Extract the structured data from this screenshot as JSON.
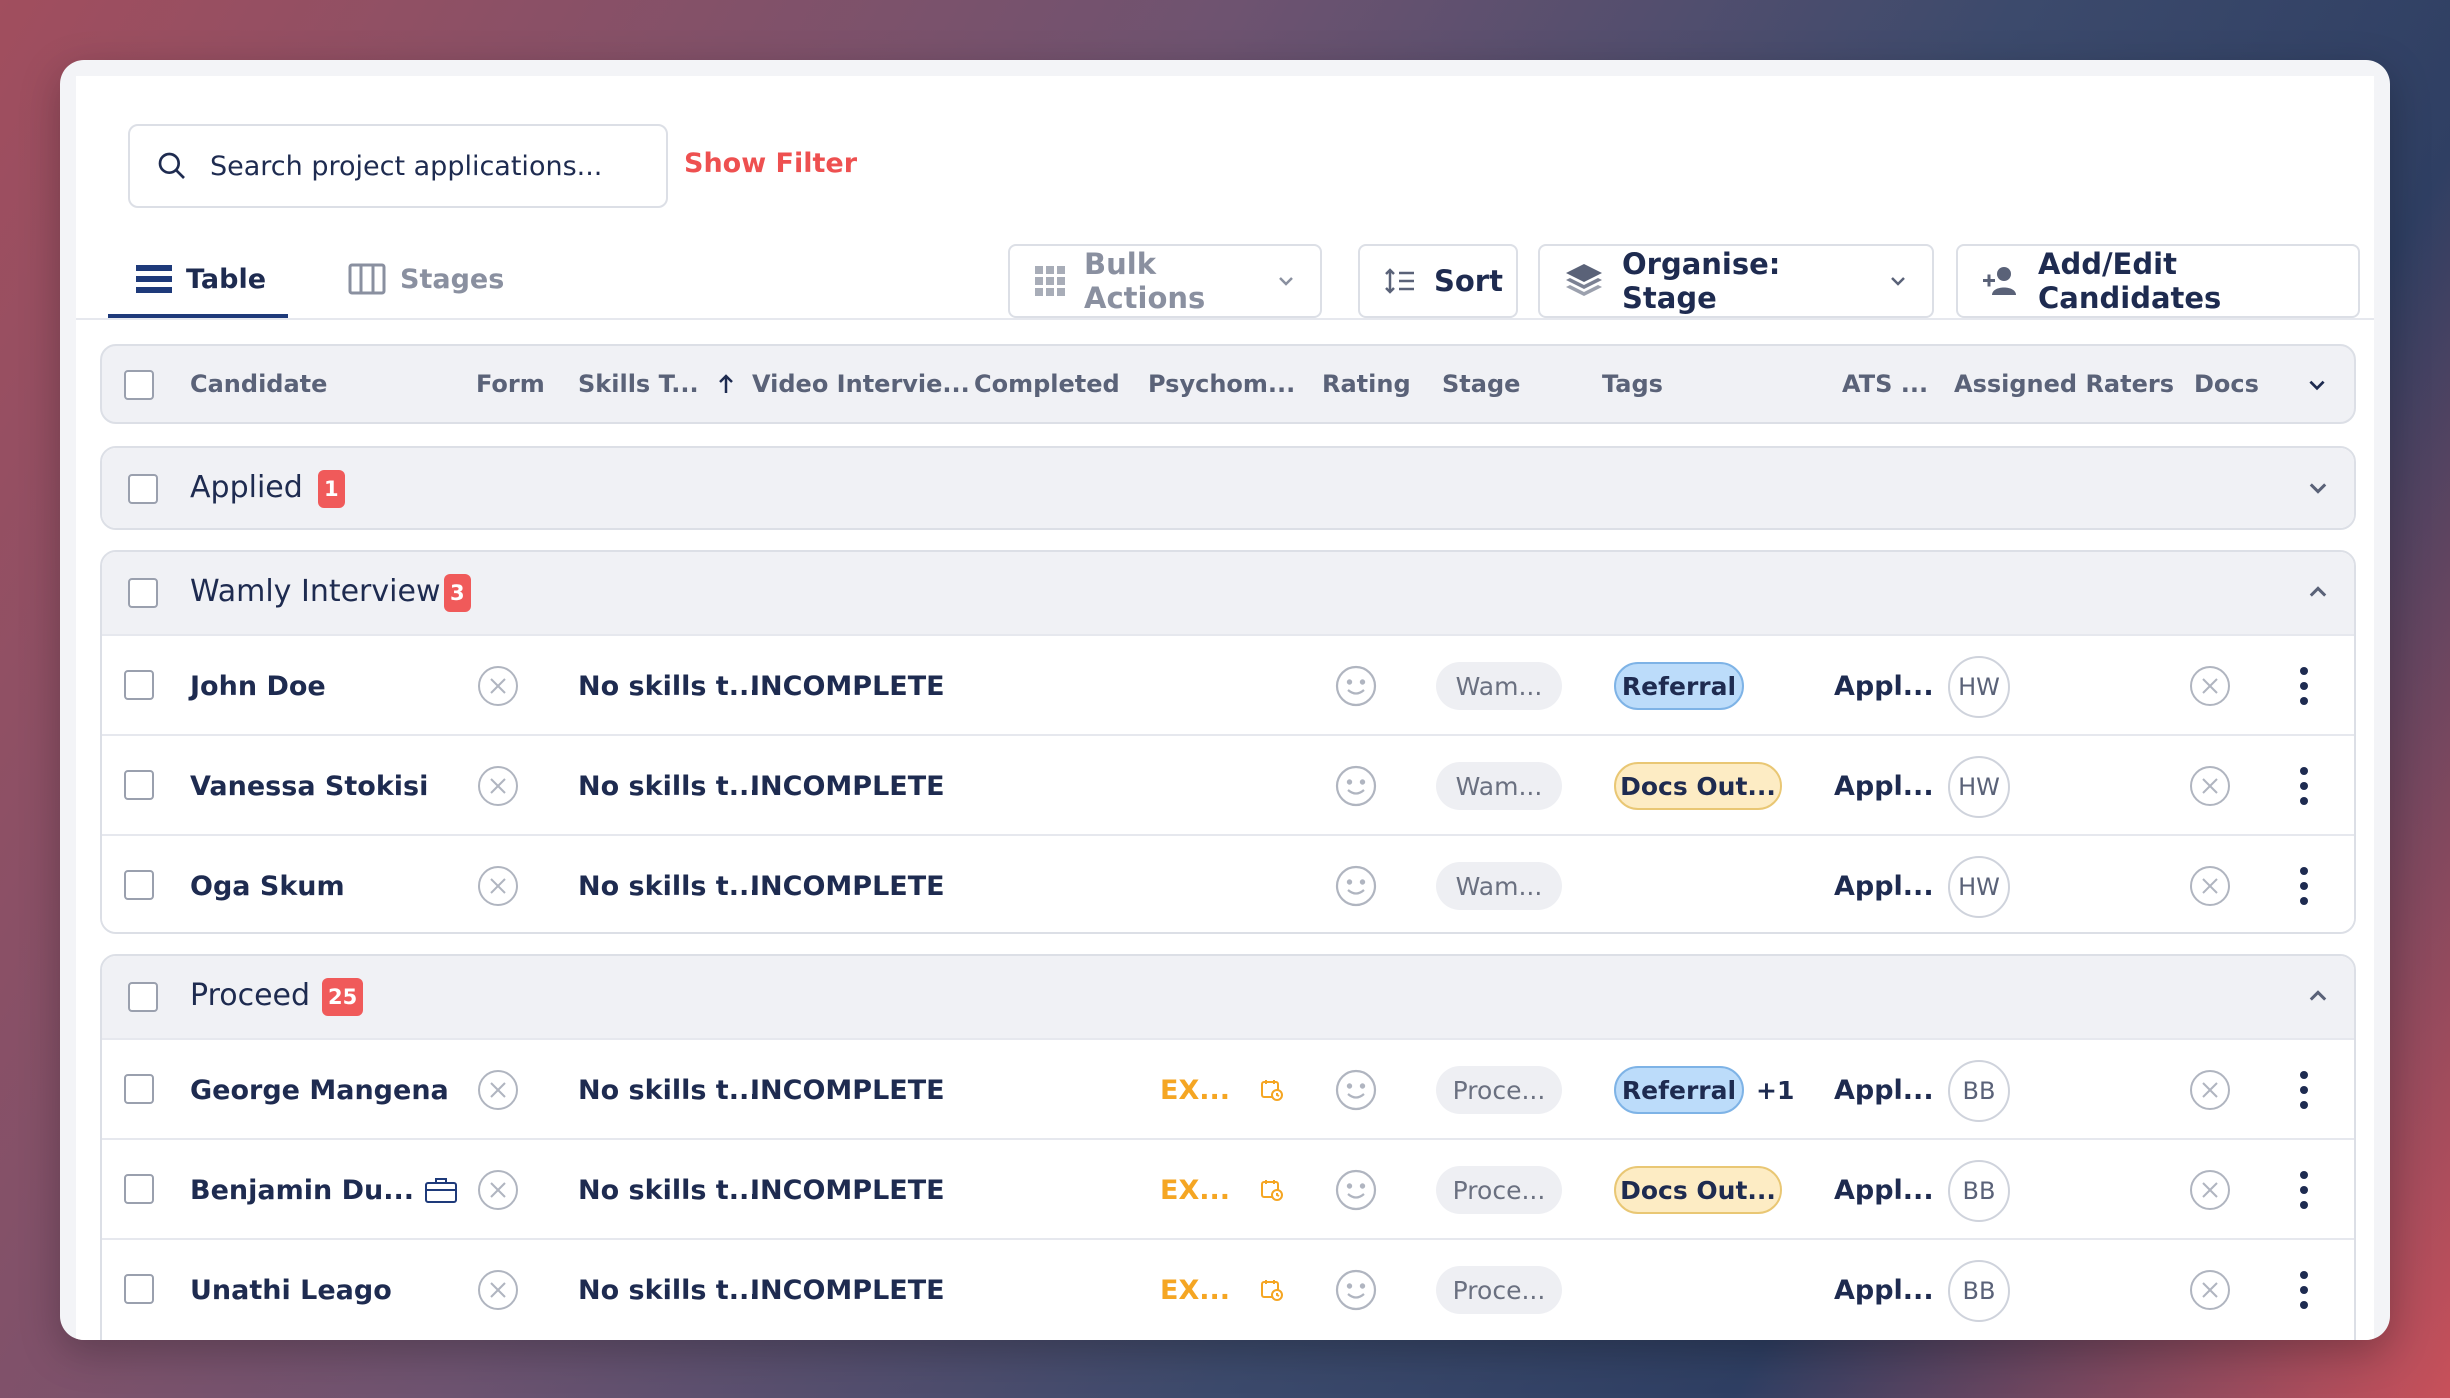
{
  "search": {
    "placeholder": "Search project applications..."
  },
  "show_filter_label": "Show Filter",
  "tabs": [
    {
      "label": "Table",
      "active": true
    },
    {
      "label": "Stages",
      "active": false
    }
  ],
  "toolbar": {
    "bulk_actions": "Bulk Actions",
    "sort": "Sort",
    "organise": "Organise: Stage",
    "add_edit": "Add/Edit Candidates"
  },
  "columns": {
    "candidate": "Candidate",
    "form": "Form",
    "skills": "Skills T...",
    "video": "Video Intervie...",
    "completed": "Completed",
    "psychom": "Psychom...",
    "rating": "Rating",
    "stage": "Stage",
    "tags": "Tags",
    "ats": "ATS ...",
    "raters": "Assigned Raters",
    "docs": "Docs"
  },
  "groups": {
    "applied": {
      "title": "Applied",
      "count": "1"
    },
    "wamly": {
      "title": "Wamly Interview",
      "count": "3",
      "rows": [
        {
          "name": "John Doe",
          "skills": "No skills t...",
          "video": "INCOMPLETE",
          "stage": "Wam...",
          "tag": "Referral",
          "ats": "Appl...",
          "rater": "HW"
        },
        {
          "name": "Vanessa Stokisi",
          "skills": "No skills t...",
          "video": "INCOMPLETE",
          "stage": "Wam...",
          "tag": "Docs Out...",
          "ats": "Appl...",
          "rater": "HW"
        },
        {
          "name": "Oga Skum",
          "skills": "No skills t...",
          "video": "INCOMPLETE",
          "stage": "Wam...",
          "ats": "Appl...",
          "rater": "HW"
        }
      ]
    },
    "proceed": {
      "title": "Proceed",
      "count": "25",
      "rows": [
        {
          "name": "George Mangena",
          "skills": "No skills t...",
          "video": "INCOMPLETE",
          "psychom": "EX...",
          "stage": "Proce...",
          "tag": "Referral",
          "extra": "+1",
          "ats": "Appl...",
          "rater": "BB"
        },
        {
          "name": "Benjamin Du...",
          "skills": "No skills t...",
          "video": "INCOMPLETE",
          "psychom": "EX...",
          "stage": "Proce...",
          "tag": "Docs Out...",
          "ats": "Appl...",
          "rater": "BB"
        },
        {
          "name": "Unathi Leago",
          "skills": "No skills t...",
          "video": "INCOMPLETE",
          "psychom": "EX...",
          "stage": "Proce...",
          "ats": "Appl...",
          "rater": "BB"
        }
      ]
    }
  },
  "colors": {
    "accent_red": "#ee5050",
    "navy": "#1e2b50",
    "orange": "#f5a623",
    "tag_blue": "#bcdcfa",
    "tag_yellow": "#fdecc4"
  }
}
